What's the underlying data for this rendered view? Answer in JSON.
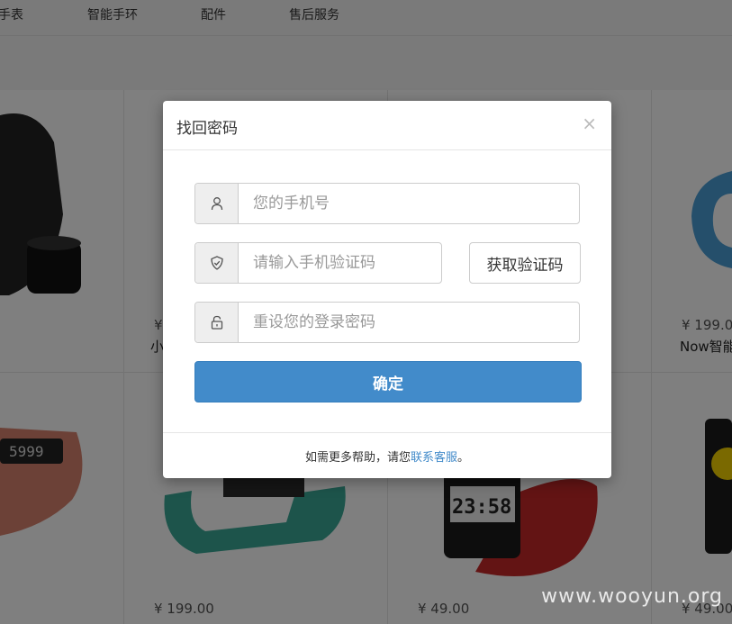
{
  "nav": {
    "items": [
      "手表",
      "智能手环",
      "配件",
      "售后服务"
    ]
  },
  "products": {
    "row1": [
      {
        "price": "¥",
        "name": "小"
      },
      {
        "price": "¥ 199.0",
        "name": "Now智能"
      }
    ],
    "row2": [
      {
        "price": "¥ 199.00",
        "name": ""
      },
      {
        "price": "¥ 49.00",
        "name": ""
      },
      {
        "price": "¥ 49.00",
        "name": ""
      }
    ],
    "band_display": "5999",
    "watch_time": "23:58"
  },
  "watermark": "www.wooyun.org",
  "modal": {
    "title": "找回密码",
    "close": "×",
    "phone_placeholder": "您的手机号",
    "code_placeholder": "请输入手机验证码",
    "get_code_label": "获取验证码",
    "password_placeholder": "重设您的登录密码",
    "confirm_label": "确定",
    "footer_prefix": "如需更多帮助，请您",
    "footer_link": "联系客服",
    "footer_suffix": "。"
  },
  "colors": {
    "primary": "#428bca",
    "overlay": "rgba(0,0,0,0.5)"
  }
}
